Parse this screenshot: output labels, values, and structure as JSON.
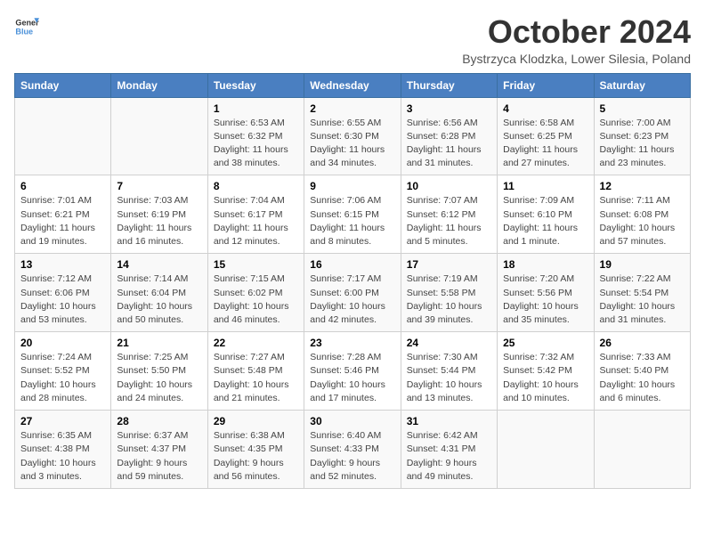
{
  "logo": {
    "line1": "General",
    "line2": "Blue"
  },
  "title": "October 2024",
  "subtitle": "Bystrzyca Klodzka, Lower Silesia, Poland",
  "weekdays": [
    "Sunday",
    "Monday",
    "Tuesday",
    "Wednesday",
    "Thursday",
    "Friday",
    "Saturday"
  ],
  "weeks": [
    [
      {
        "day": "",
        "sunrise": "",
        "sunset": "",
        "daylight": ""
      },
      {
        "day": "",
        "sunrise": "",
        "sunset": "",
        "daylight": ""
      },
      {
        "day": "1",
        "sunrise": "Sunrise: 6:53 AM",
        "sunset": "Sunset: 6:32 PM",
        "daylight": "Daylight: 11 hours and 38 minutes."
      },
      {
        "day": "2",
        "sunrise": "Sunrise: 6:55 AM",
        "sunset": "Sunset: 6:30 PM",
        "daylight": "Daylight: 11 hours and 34 minutes."
      },
      {
        "day": "3",
        "sunrise": "Sunrise: 6:56 AM",
        "sunset": "Sunset: 6:28 PM",
        "daylight": "Daylight: 11 hours and 31 minutes."
      },
      {
        "day": "4",
        "sunrise": "Sunrise: 6:58 AM",
        "sunset": "Sunset: 6:25 PM",
        "daylight": "Daylight: 11 hours and 27 minutes."
      },
      {
        "day": "5",
        "sunrise": "Sunrise: 7:00 AM",
        "sunset": "Sunset: 6:23 PM",
        "daylight": "Daylight: 11 hours and 23 minutes."
      }
    ],
    [
      {
        "day": "6",
        "sunrise": "Sunrise: 7:01 AM",
        "sunset": "Sunset: 6:21 PM",
        "daylight": "Daylight: 11 hours and 19 minutes."
      },
      {
        "day": "7",
        "sunrise": "Sunrise: 7:03 AM",
        "sunset": "Sunset: 6:19 PM",
        "daylight": "Daylight: 11 hours and 16 minutes."
      },
      {
        "day": "8",
        "sunrise": "Sunrise: 7:04 AM",
        "sunset": "Sunset: 6:17 PM",
        "daylight": "Daylight: 11 hours and 12 minutes."
      },
      {
        "day": "9",
        "sunrise": "Sunrise: 7:06 AM",
        "sunset": "Sunset: 6:15 PM",
        "daylight": "Daylight: 11 hours and 8 minutes."
      },
      {
        "day": "10",
        "sunrise": "Sunrise: 7:07 AM",
        "sunset": "Sunset: 6:12 PM",
        "daylight": "Daylight: 11 hours and 5 minutes."
      },
      {
        "day": "11",
        "sunrise": "Sunrise: 7:09 AM",
        "sunset": "Sunset: 6:10 PM",
        "daylight": "Daylight: 11 hours and 1 minute."
      },
      {
        "day": "12",
        "sunrise": "Sunrise: 7:11 AM",
        "sunset": "Sunset: 6:08 PM",
        "daylight": "Daylight: 10 hours and 57 minutes."
      }
    ],
    [
      {
        "day": "13",
        "sunrise": "Sunrise: 7:12 AM",
        "sunset": "Sunset: 6:06 PM",
        "daylight": "Daylight: 10 hours and 53 minutes."
      },
      {
        "day": "14",
        "sunrise": "Sunrise: 7:14 AM",
        "sunset": "Sunset: 6:04 PM",
        "daylight": "Daylight: 10 hours and 50 minutes."
      },
      {
        "day": "15",
        "sunrise": "Sunrise: 7:15 AM",
        "sunset": "Sunset: 6:02 PM",
        "daylight": "Daylight: 10 hours and 46 minutes."
      },
      {
        "day": "16",
        "sunrise": "Sunrise: 7:17 AM",
        "sunset": "Sunset: 6:00 PM",
        "daylight": "Daylight: 10 hours and 42 minutes."
      },
      {
        "day": "17",
        "sunrise": "Sunrise: 7:19 AM",
        "sunset": "Sunset: 5:58 PM",
        "daylight": "Daylight: 10 hours and 39 minutes."
      },
      {
        "day": "18",
        "sunrise": "Sunrise: 7:20 AM",
        "sunset": "Sunset: 5:56 PM",
        "daylight": "Daylight: 10 hours and 35 minutes."
      },
      {
        "day": "19",
        "sunrise": "Sunrise: 7:22 AM",
        "sunset": "Sunset: 5:54 PM",
        "daylight": "Daylight: 10 hours and 31 minutes."
      }
    ],
    [
      {
        "day": "20",
        "sunrise": "Sunrise: 7:24 AM",
        "sunset": "Sunset: 5:52 PM",
        "daylight": "Daylight: 10 hours and 28 minutes."
      },
      {
        "day": "21",
        "sunrise": "Sunrise: 7:25 AM",
        "sunset": "Sunset: 5:50 PM",
        "daylight": "Daylight: 10 hours and 24 minutes."
      },
      {
        "day": "22",
        "sunrise": "Sunrise: 7:27 AM",
        "sunset": "Sunset: 5:48 PM",
        "daylight": "Daylight: 10 hours and 21 minutes."
      },
      {
        "day": "23",
        "sunrise": "Sunrise: 7:28 AM",
        "sunset": "Sunset: 5:46 PM",
        "daylight": "Daylight: 10 hours and 17 minutes."
      },
      {
        "day": "24",
        "sunrise": "Sunrise: 7:30 AM",
        "sunset": "Sunset: 5:44 PM",
        "daylight": "Daylight: 10 hours and 13 minutes."
      },
      {
        "day": "25",
        "sunrise": "Sunrise: 7:32 AM",
        "sunset": "Sunset: 5:42 PM",
        "daylight": "Daylight: 10 hours and 10 minutes."
      },
      {
        "day": "26",
        "sunrise": "Sunrise: 7:33 AM",
        "sunset": "Sunset: 5:40 PM",
        "daylight": "Daylight: 10 hours and 6 minutes."
      }
    ],
    [
      {
        "day": "27",
        "sunrise": "Sunrise: 6:35 AM",
        "sunset": "Sunset: 4:38 PM",
        "daylight": "Daylight: 10 hours and 3 minutes."
      },
      {
        "day": "28",
        "sunrise": "Sunrise: 6:37 AM",
        "sunset": "Sunset: 4:37 PM",
        "daylight": "Daylight: 9 hours and 59 minutes."
      },
      {
        "day": "29",
        "sunrise": "Sunrise: 6:38 AM",
        "sunset": "Sunset: 4:35 PM",
        "daylight": "Daylight: 9 hours and 56 minutes."
      },
      {
        "day": "30",
        "sunrise": "Sunrise: 6:40 AM",
        "sunset": "Sunset: 4:33 PM",
        "daylight": "Daylight: 9 hours and 52 minutes."
      },
      {
        "day": "31",
        "sunrise": "Sunrise: 6:42 AM",
        "sunset": "Sunset: 4:31 PM",
        "daylight": "Daylight: 9 hours and 49 minutes."
      },
      {
        "day": "",
        "sunrise": "",
        "sunset": "",
        "daylight": ""
      },
      {
        "day": "",
        "sunrise": "",
        "sunset": "",
        "daylight": ""
      }
    ]
  ]
}
